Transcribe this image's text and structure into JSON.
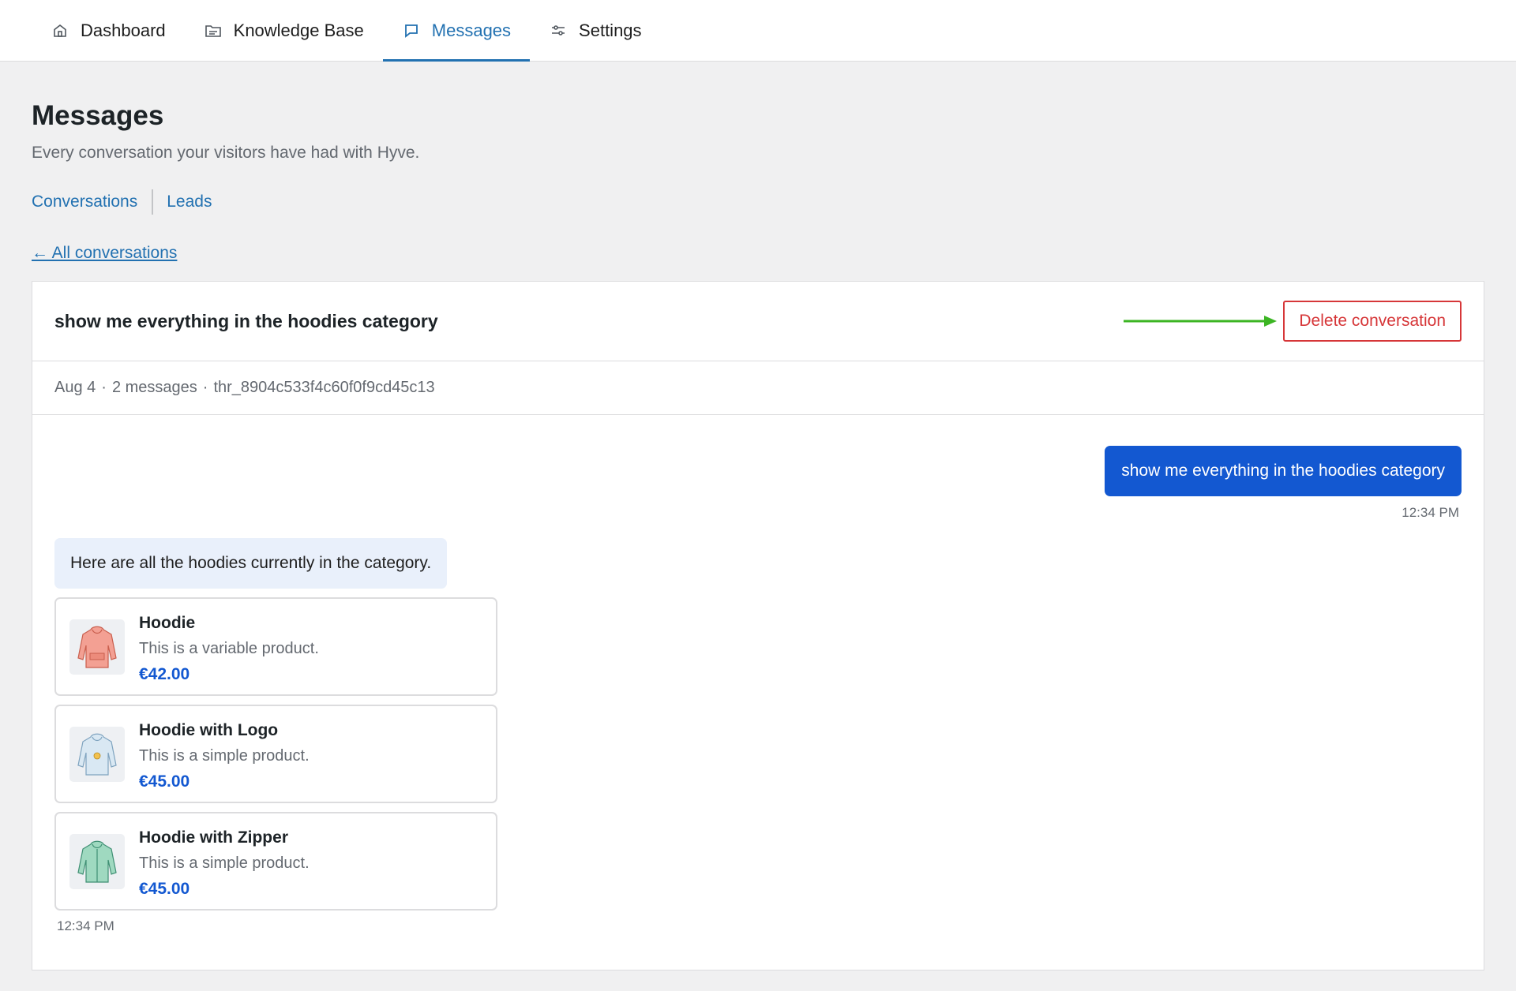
{
  "nav": {
    "tabs": [
      {
        "label": "Dashboard",
        "icon": "home-icon"
      },
      {
        "label": "Knowledge Base",
        "icon": "folder-icon"
      },
      {
        "label": "Messages",
        "icon": "message-icon",
        "active": true
      },
      {
        "label": "Settings",
        "icon": "sliders-icon"
      }
    ]
  },
  "page": {
    "title": "Messages",
    "subtitle": "Every conversation your visitors have had with Hyve.",
    "subnav": [
      "Conversations",
      "Leads"
    ],
    "back_link": "← All conversations"
  },
  "conversation": {
    "title": "show me everything in the hoodies category",
    "delete_label": "Delete conversation",
    "meta": {
      "date": "Aug 4",
      "message_count": "2 messages",
      "thread_id": "thr_8904c533f4c60f0f9cd45c13"
    },
    "user_message": {
      "text": "show me everything in the hoodies category",
      "time": "12:34 PM"
    },
    "bot_message": {
      "text": "Here are all the hoodies currently in the category.",
      "time": "12:34 PM",
      "products": [
        {
          "name": "Hoodie",
          "description": "This is a variable product.",
          "price": "€42.00",
          "image": "pink-hoodie"
        },
        {
          "name": "Hoodie with Logo",
          "description": "This is a simple product.",
          "price": "€45.00",
          "image": "blue-logo-hoodie"
        },
        {
          "name": "Hoodie with Zipper",
          "description": "This is a simple product.",
          "price": "€45.00",
          "image": "green-zip-hoodie"
        }
      ]
    }
  },
  "colors": {
    "accent": "#2271b1",
    "user_bubble": "#1358d1",
    "bot_bubble": "#e9f0fb",
    "danger": "#d63638",
    "annotation_arrow": "#3cb523"
  }
}
